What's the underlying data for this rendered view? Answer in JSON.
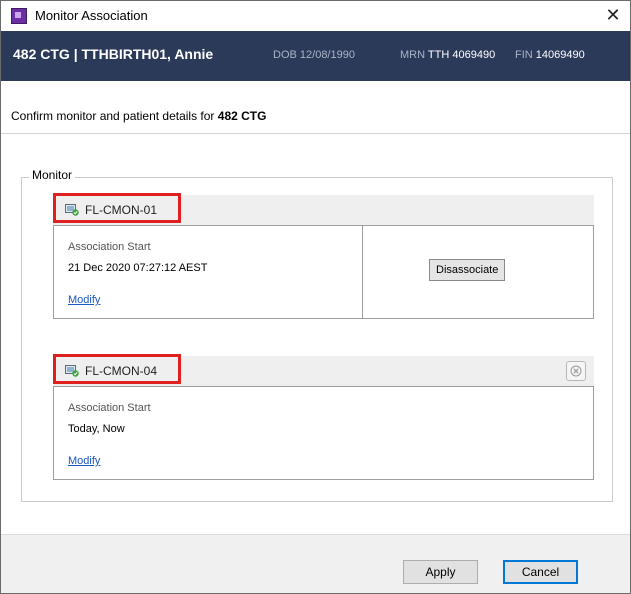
{
  "window": {
    "title": "Monitor Association",
    "close_glyph": "✕"
  },
  "banner": {
    "main": "482 CTG | TTHBIRTH01, Annie",
    "dob_label": "DOB",
    "dob": "12/08/1990",
    "mrn_label": "MRN",
    "mrn": "TTH 4069490",
    "fin_label": "FIN",
    "fin": "14069490"
  },
  "subheader": {
    "prefix": "Confirm monitor and patient details for ",
    "bold": "482 CTG"
  },
  "monitor_section": {
    "legend": "Monitor",
    "cards": [
      {
        "name": "FL-CMON-01",
        "association_label": "Association Start",
        "association_value": "21 Dec 2020 07:27:12 AEST",
        "modify_label": "Modify",
        "action_label": "Disassociate"
      },
      {
        "name": "FL-CMON-04",
        "association_label": "Association Start",
        "association_value": "Today, Now",
        "modify_label": "Modify"
      }
    ]
  },
  "footer": {
    "apply_label": "Apply",
    "cancel_label": "Cancel"
  },
  "colors": {
    "banner_bg": "#2c3a5a",
    "highlight_border": "#e01f1f",
    "link": "#1a56c4",
    "cancel_focus": "#0078d7"
  },
  "icons": {
    "app": "app-icon",
    "monitor": "monitor-icon",
    "remove": "remove-circle-icon",
    "close": "close-icon"
  }
}
